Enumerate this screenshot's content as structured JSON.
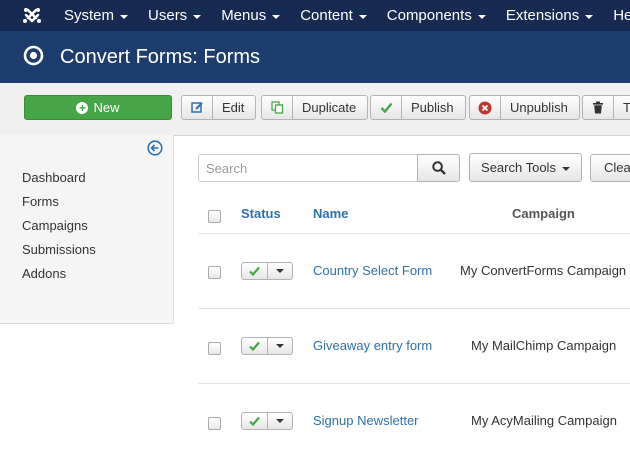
{
  "topnav": {
    "items": [
      {
        "label": "System"
      },
      {
        "label": "Users"
      },
      {
        "label": "Menus"
      },
      {
        "label": "Content"
      },
      {
        "label": "Components"
      },
      {
        "label": "Extensions"
      },
      {
        "label": "He"
      }
    ]
  },
  "header": {
    "title": "Convert Forms: Forms"
  },
  "toolbar": {
    "new_label": "New",
    "edit_label": "Edit",
    "duplicate_label": "Duplicate",
    "publish_label": "Publish",
    "unpublish_label": "Unpublish",
    "trash_label": "Tr"
  },
  "sidebar": {
    "items": [
      {
        "label": "Dashboard"
      },
      {
        "label": "Forms"
      },
      {
        "label": "Campaigns"
      },
      {
        "label": "Submissions"
      },
      {
        "label": "Addons"
      }
    ]
  },
  "search": {
    "placeholder": "Search",
    "tools_label": "Search Tools",
    "clear_label": "Clea"
  },
  "table": {
    "headers": {
      "status": "Status",
      "name": "Name",
      "campaign": "Campaign"
    },
    "rows": [
      {
        "name": "Country Select Form",
        "campaign": "My ConvertForms Campaign"
      },
      {
        "name": "Giveaway entry form",
        "campaign": "My MailChimp Campaign"
      },
      {
        "name": "Signup Newsletter",
        "campaign": "My AcyMailing Campaign"
      }
    ]
  },
  "colors": {
    "topnav": "#162a52",
    "header": "#1c3d6e",
    "new_button": "#46a546",
    "link": "#3071a9",
    "published_check": "#46a546",
    "unpublish_icon": "#bd362f"
  }
}
